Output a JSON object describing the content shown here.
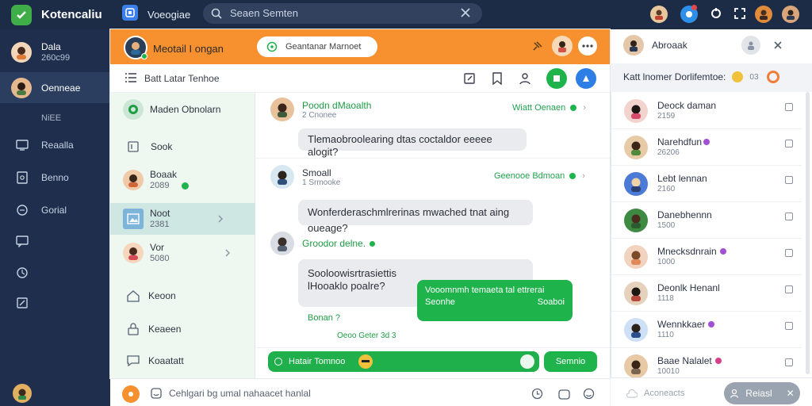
{
  "topbar": {
    "app_name": "Kotencaliu",
    "section_name": "Voeogiae",
    "search_value": "Seaen Semten"
  },
  "leftnav": {
    "user": {
      "name": "Dala",
      "status": "260c99"
    },
    "active_item": "Oenneae",
    "section_label": "NiEE",
    "items": [
      "Reaalla",
      "Benno",
      "Gorial"
    ]
  },
  "chat_header": {
    "name": "Meotail I   ongan",
    "action_label": "Geantanar Marnoet"
  },
  "toolbar": {
    "title": "Batt Latar Tenhoe"
  },
  "conversations": [
    {
      "name": "Maden Obnolarn",
      "sub": ""
    },
    {
      "name": "Sook",
      "sub": ""
    },
    {
      "name": "Boaak",
      "sub": "2089"
    },
    {
      "name": "Noot",
      "sub": "2381"
    },
    {
      "name": "Vor",
      "sub": "5080"
    },
    {
      "name": "Keoon",
      "sub": ""
    },
    {
      "name": "Keaeen",
      "sub": ""
    },
    {
      "name": "Koaatatt",
      "sub": ""
    }
  ],
  "messages": [
    {
      "sender": "Poodn dMaoalth",
      "time": "2 Cnonee",
      "right_label": "Wiatt Oenaen",
      "text": "Tlemaobroolearing dtas coctaldor eeeee alogit?"
    },
    {
      "sender": "Smoall",
      "time": "1 Srmooke",
      "right_label": "Geenooe Bdmoan",
      "text": "Wonferderaschmlrerinas mwached tnat aing oueage?"
    },
    {
      "sender": "Groodor delne.",
      "time": "",
      "right_label": "",
      "text": "Sooloowisrtrasiettis lHooaklo poalre?",
      "reply": "Bonan ?",
      "reply_time": "Oeoo Geter 3d 3"
    }
  ],
  "outgoing": {
    "text": "Vooomnmh temaeta tal ettrerai ",
    "subtext": "Seonhe",
    "right_text": "Soaboi"
  },
  "composer": {
    "placeholder": "Hatair Tomnoo",
    "send_label": "Semnio"
  },
  "footer": {
    "placeholder": "Cehlgari bg umal nahaacet hanlal"
  },
  "contacts": {
    "header_name": "Abroaak",
    "subheader": "Katt lnomer Dorlifemtoe:",
    "subheader_extra": "03",
    "list": [
      {
        "name": "Deock daman",
        "sub": "2159"
      },
      {
        "name": "Narehdfun",
        "sub": "26206"
      },
      {
        "name": "Lebt lennan",
        "sub": "2160"
      },
      {
        "name": "Danebhennn",
        "sub": "1500"
      },
      {
        "name": "Mnecksdnrain",
        "sub": "1000"
      },
      {
        "name": "Deonlk Henanl",
        "sub": "1118"
      },
      {
        "name": "Wennkkaer",
        "sub": "1110"
      },
      {
        "name": "Baae Nalalet",
        "sub": "10010"
      }
    ],
    "footer_left": "Aconeacts",
    "button_label": "Reiasl"
  },
  "colors": {
    "topbar": "#1c2c46",
    "nav": "#1e2e4c",
    "header_orange": "#f7912f",
    "green": "#1fb34c",
    "list_bg": "#eef8f1"
  }
}
